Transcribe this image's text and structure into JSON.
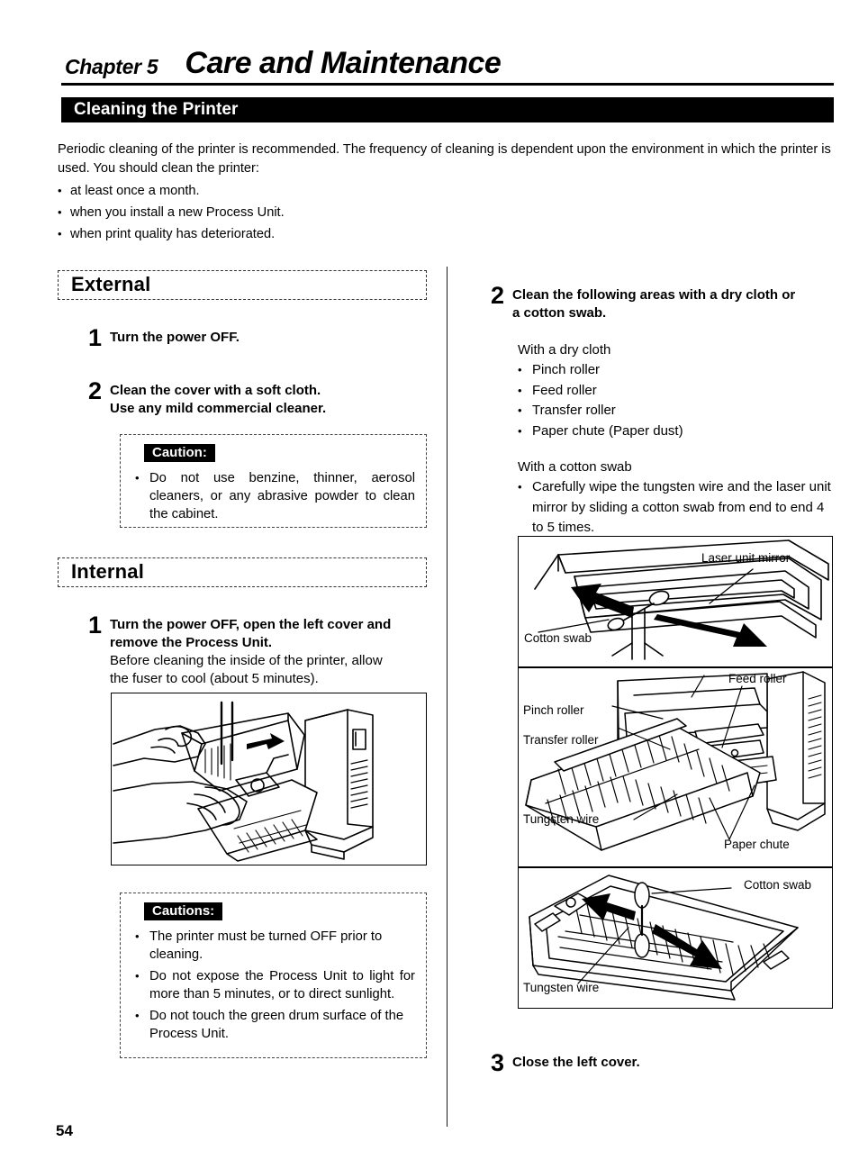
{
  "header": {
    "chapter_label": "Chapter 5",
    "chapter_title": "Care and Maintenance",
    "section_title": "Cleaning the Printer"
  },
  "intro": {
    "paragraph": "Periodic cleaning of the printer is recommended. The frequency of cleaning is dependent upon the environment in which the printer is used. You should clean the printer:",
    "bullets": [
      "at least once a month.",
      "when you install a new Process Unit.",
      "when print quality has deteriorated."
    ]
  },
  "external": {
    "heading": "External",
    "step1": {
      "number": "1",
      "line1": "Turn the power OFF."
    },
    "step2": {
      "number": "2",
      "line1": "Clean the cover with a soft cloth.",
      "line2": "Use any mild commercial cleaner."
    },
    "caution": {
      "tag": "Caution:",
      "items": [
        "Do not use benzine, thinner, aerosol cleaners, or any abrasive powder to clean the cabinet."
      ]
    }
  },
  "internal": {
    "heading": "Internal",
    "step1": {
      "number": "1",
      "bold_line1": "Turn the power OFF, open the left cover and",
      "bold_line2": "remove the Process Unit.",
      "plain_line1": "Before cleaning the inside of the printer, allow",
      "plain_line2": "the fuser to cool (about 5 minutes)."
    },
    "figure": {
      "name": "process-unit-removal-illustration"
    },
    "cautions": {
      "tag": "Cautions:",
      "items": [
        "The printer must be turned OFF prior to cleaning.",
        "Do not expose the Process Unit to light for more than 5 minutes, or to direct sunlight.",
        "Do not touch the green drum surface of the Process Unit."
      ]
    }
  },
  "right_column": {
    "step2": {
      "number": "2",
      "bold_line1": "Clean the following areas with a dry cloth or",
      "bold_line2": "a cotton swab.",
      "dry_cloth_label": "With a dry cloth",
      "dry_cloth_items": [
        "Pinch roller",
        "Feed roller",
        "Transfer roller",
        "Paper chute (Paper dust)"
      ],
      "cotton_swab_label": "With a cotton swab",
      "cotton_swab_items": [
        "Carefully wipe the tungsten wire and the laser unit mirror by sliding a cotton swab from end to end 4 to 5 times."
      ]
    },
    "figures": {
      "top": {
        "name": "laser-unit-mirror-illustration",
        "labels": [
          "Laser unit mirror",
          "Cotton swab"
        ]
      },
      "middle": {
        "name": "printer-rollers-illustration",
        "labels": [
          "Feed roller",
          "Pinch roller",
          "Transfer roller",
          "Tungsten wire",
          "Paper chute"
        ]
      },
      "bottom": {
        "name": "tungsten-wire-cleaning-illustration",
        "labels": [
          "Cotton swab",
          "Tungsten wire"
        ]
      }
    },
    "step3": {
      "number": "3",
      "line1": "Close the left cover."
    }
  },
  "footer": {
    "page_number": "54"
  }
}
